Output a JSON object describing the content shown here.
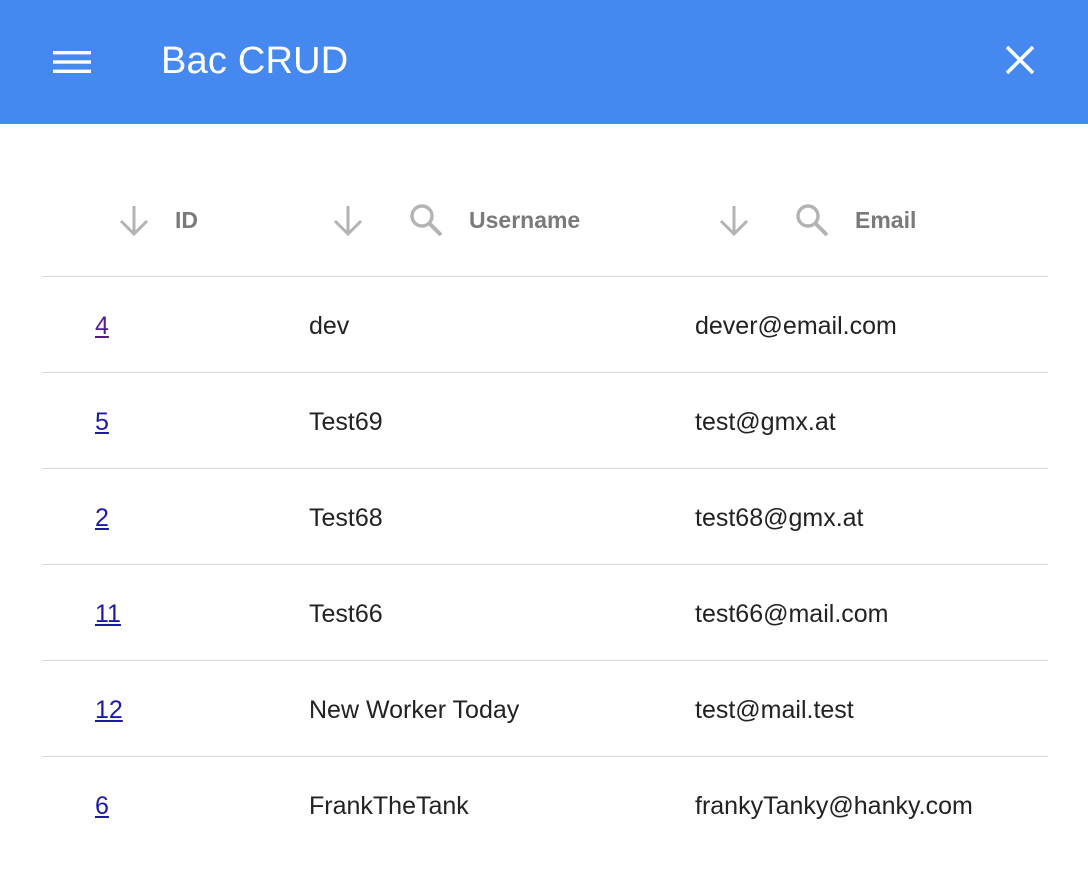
{
  "app": {
    "title": "Bac CRUD",
    "colors": {
      "app_bar": "#4589f0",
      "link": "#1a1aa6",
      "visited_link": "#551a8b"
    }
  },
  "icons": {
    "menu": "menu-icon",
    "close": "close-icon",
    "sort": "arrow-down-icon",
    "search": "search-icon"
  },
  "table": {
    "columns": [
      {
        "label": "ID",
        "sortable": true,
        "searchable": false
      },
      {
        "label": "Username",
        "sortable": true,
        "searchable": true
      },
      {
        "label": "Email",
        "sortable": true,
        "searchable": true
      }
    ],
    "rows": [
      {
        "id": "4",
        "username": "dev",
        "email": "dever@email.com",
        "visited": true
      },
      {
        "id": "5",
        "username": "Test69",
        "email": "test@gmx.at",
        "visited": false
      },
      {
        "id": "2",
        "username": "Test68",
        "email": "test68@gmx.at",
        "visited": false
      },
      {
        "id": "11",
        "username": "Test66",
        "email": "test66@mail.com",
        "visited": false
      },
      {
        "id": "12",
        "username": "New Worker Today",
        "email": "test@mail.test",
        "visited": false
      },
      {
        "id": "6",
        "username": "FrankTheTank",
        "email": "frankyTanky@hanky.com",
        "visited": false
      }
    ]
  }
}
